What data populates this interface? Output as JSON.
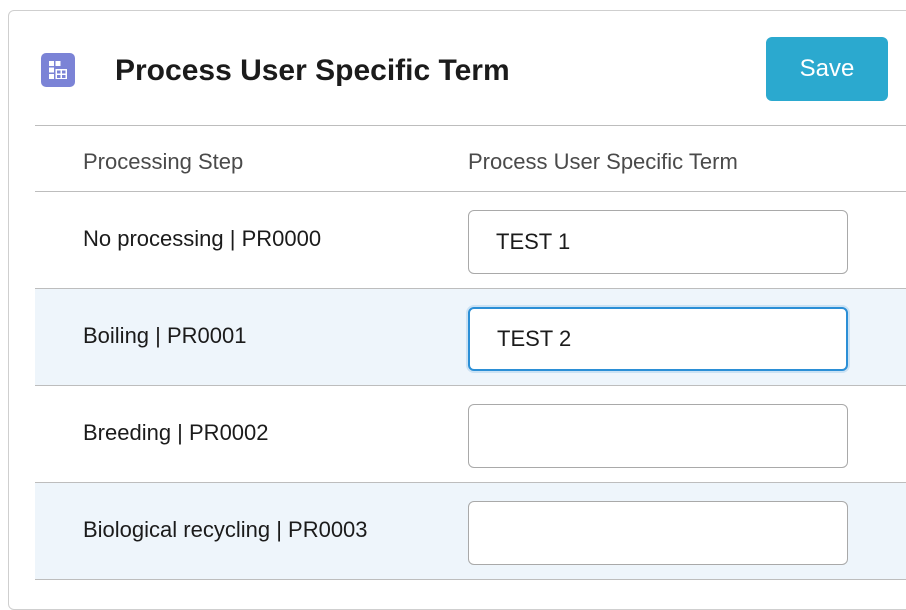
{
  "header": {
    "title": "Process User Specific Term",
    "save_label": "Save",
    "icon": "table-grid-icon",
    "icon_color": "#7b83d6",
    "save_color": "#2ba9cf"
  },
  "table": {
    "columns": [
      "Processing Step",
      "Process User Specific Term"
    ],
    "rows": [
      {
        "step": "No processing | PR0000",
        "term": "TEST 1",
        "placeholder": ""
      },
      {
        "step": "Boiling | PR0001",
        "term": "TEST 2",
        "placeholder": "",
        "focused": true
      },
      {
        "step": "Breeding | PR0002",
        "term": "",
        "placeholder": ""
      },
      {
        "step": "Biological recycling | PR0003",
        "term": "",
        "placeholder": ""
      }
    ],
    "alt_row_color": "#eef5fb",
    "focus_color": "#2b8fd6"
  }
}
